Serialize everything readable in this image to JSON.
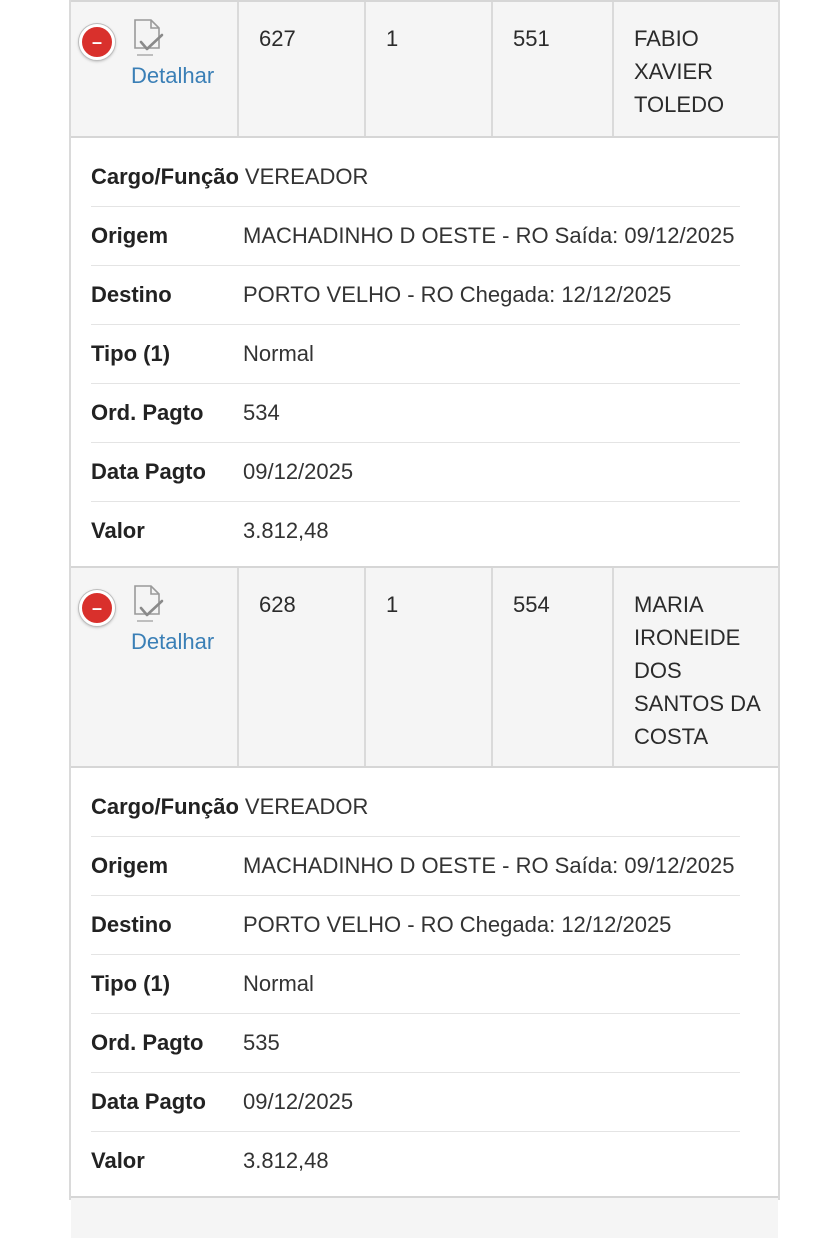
{
  "common": {
    "detail_link": "Detalhar",
    "remove_symbol": "–",
    "labels": {
      "cargo": "Cargo/Função",
      "origem": "Origem",
      "destino": "Destino",
      "tipo": "Tipo (1)",
      "ord_pagto": "Ord. Pagto",
      "data_pagto": "Data Pagto",
      "valor": "Valor"
    }
  },
  "records": [
    {
      "col1": "627",
      "col2": "1",
      "col3": "551",
      "name_lines": [
        "FABIO",
        "XAVIER",
        "TOLEDO"
      ],
      "cargo": "VEREADOR",
      "origem": "MACHADINHO D OESTE - RO Saída: 09/12/2025",
      "destino": "PORTO VELHO - RO Chegada: 12/12/2025",
      "tipo": "Normal",
      "ord_pagto": "534",
      "data_pagto": "09/12/2025",
      "valor": "3.812,48"
    },
    {
      "col1": "628",
      "col2": "1",
      "col3": "554",
      "name_lines": [
        "MARIA",
        "IRONEIDE",
        "DOS",
        "SANTOS DA",
        "COSTA"
      ],
      "cargo": "VEREADOR",
      "origem": "MACHADINHO D OESTE - RO Saída: 09/12/2025",
      "destino": "PORTO VELHO - RO Chegada: 12/12/2025",
      "tipo": "Normal",
      "ord_pagto": "535",
      "data_pagto": "09/12/2025",
      "valor": "3.812,48"
    }
  ],
  "colors": {
    "remove_button": "#d9302c",
    "link": "#3a7fb6",
    "row_bg": "#f5f5f5"
  }
}
